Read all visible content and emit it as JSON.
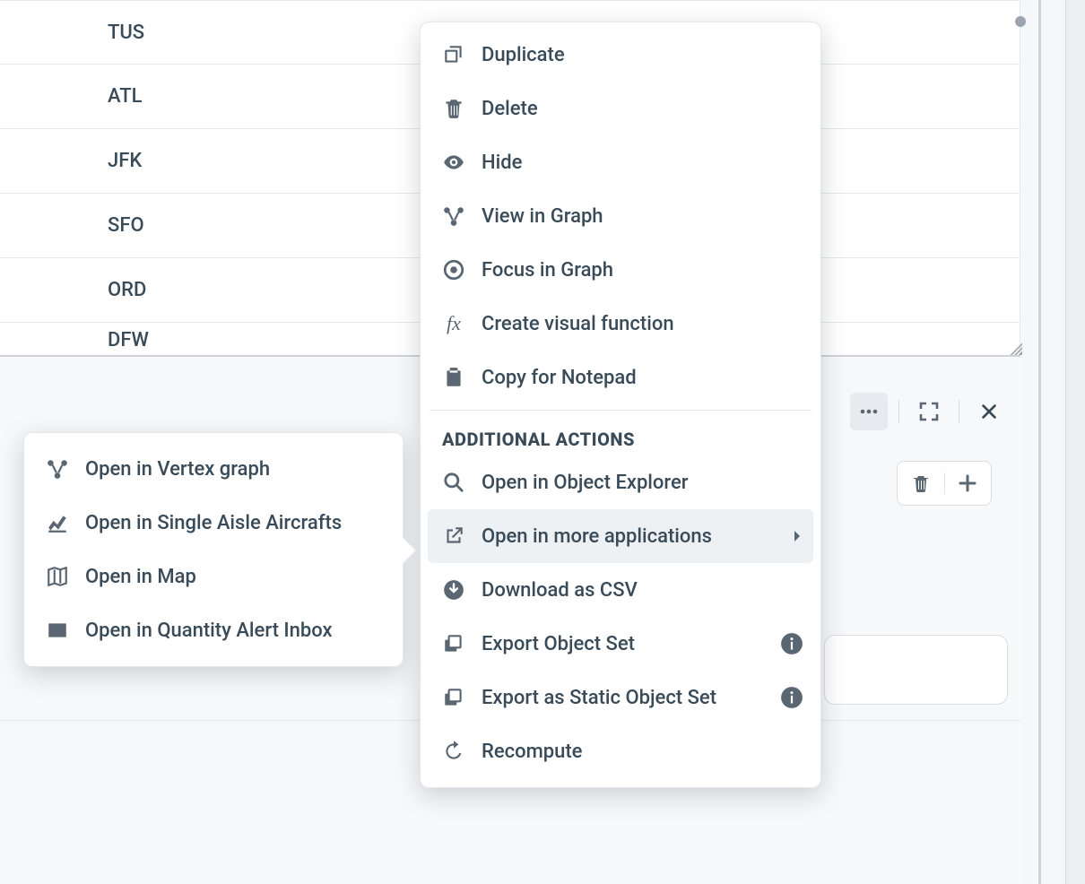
{
  "table": {
    "rows": [
      "TUS",
      "ATL",
      "JFK",
      "SFO",
      "ORD",
      "DFW"
    ]
  },
  "menu": {
    "items": [
      {
        "label": "Duplicate"
      },
      {
        "label": "Delete"
      },
      {
        "label": "Hide"
      },
      {
        "label": "View in Graph"
      },
      {
        "label": "Focus in Graph"
      },
      {
        "label": "Create visual function"
      },
      {
        "label": "Copy for Notepad"
      }
    ],
    "additional_header": "ADDITIONAL ACTIONS",
    "additional": [
      {
        "label": "Open in Object Explorer"
      },
      {
        "label": "Open in more applications"
      },
      {
        "label": "Download as CSV"
      },
      {
        "label": "Export Object Set"
      },
      {
        "label": "Export as Static Object Set"
      },
      {
        "label": "Recompute"
      }
    ]
  },
  "submenu": {
    "items": [
      {
        "label": "Open in Vertex graph"
      },
      {
        "label": "Open in Single Aisle Aircrafts"
      },
      {
        "label": "Open in Map"
      },
      {
        "label": "Open in Quantity Alert Inbox"
      }
    ]
  }
}
